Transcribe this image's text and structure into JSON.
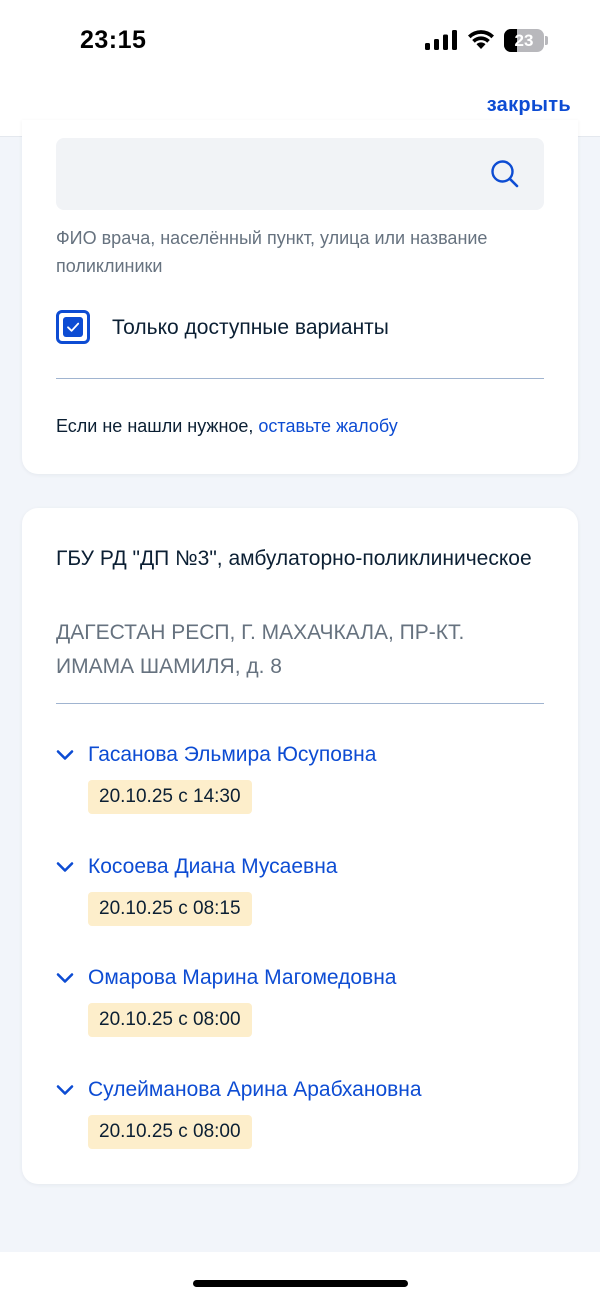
{
  "status_bar": {
    "time": "23:15",
    "battery_level": "23"
  },
  "header": {
    "close_label": "закрыть"
  },
  "search": {
    "input_value": "",
    "hint": "ФИО врача, населённый пункт, улица или название поликлиники",
    "icon": "search-icon"
  },
  "filter": {
    "checked": true,
    "label": "Только доступные варианты"
  },
  "complaint": {
    "prefix": "Если не нашли нужное, ",
    "link": "оставьте жалобу"
  },
  "clinic": {
    "name": "ГБУ РД \"ДП №3\", амбулаторно-поликлиническое",
    "address": "ДАГЕСТАН РЕСП, Г. МАХАЧКАЛА, ПР-КТ. ИМАМА ШАМИЛЯ, д. 8",
    "doctors": [
      {
        "name": "Гасанова Эльмира Юсуповна",
        "slot": "20.10.25 с 14:30"
      },
      {
        "name": "Косоева Диана Мусаевна",
        "slot": "20.10.25 с 08:15"
      },
      {
        "name": "Омарова Марина Магомедовна",
        "slot": "20.10.25 с 08:00"
      },
      {
        "name": "Сулейманова Арина Арабхановна",
        "slot": "20.10.25 с 08:00"
      }
    ]
  },
  "colors": {
    "accent": "#0d4cd3",
    "slot_bg": "#fdeecb",
    "page_bg": "#f2f5fa",
    "muted_text": "#66727f"
  }
}
